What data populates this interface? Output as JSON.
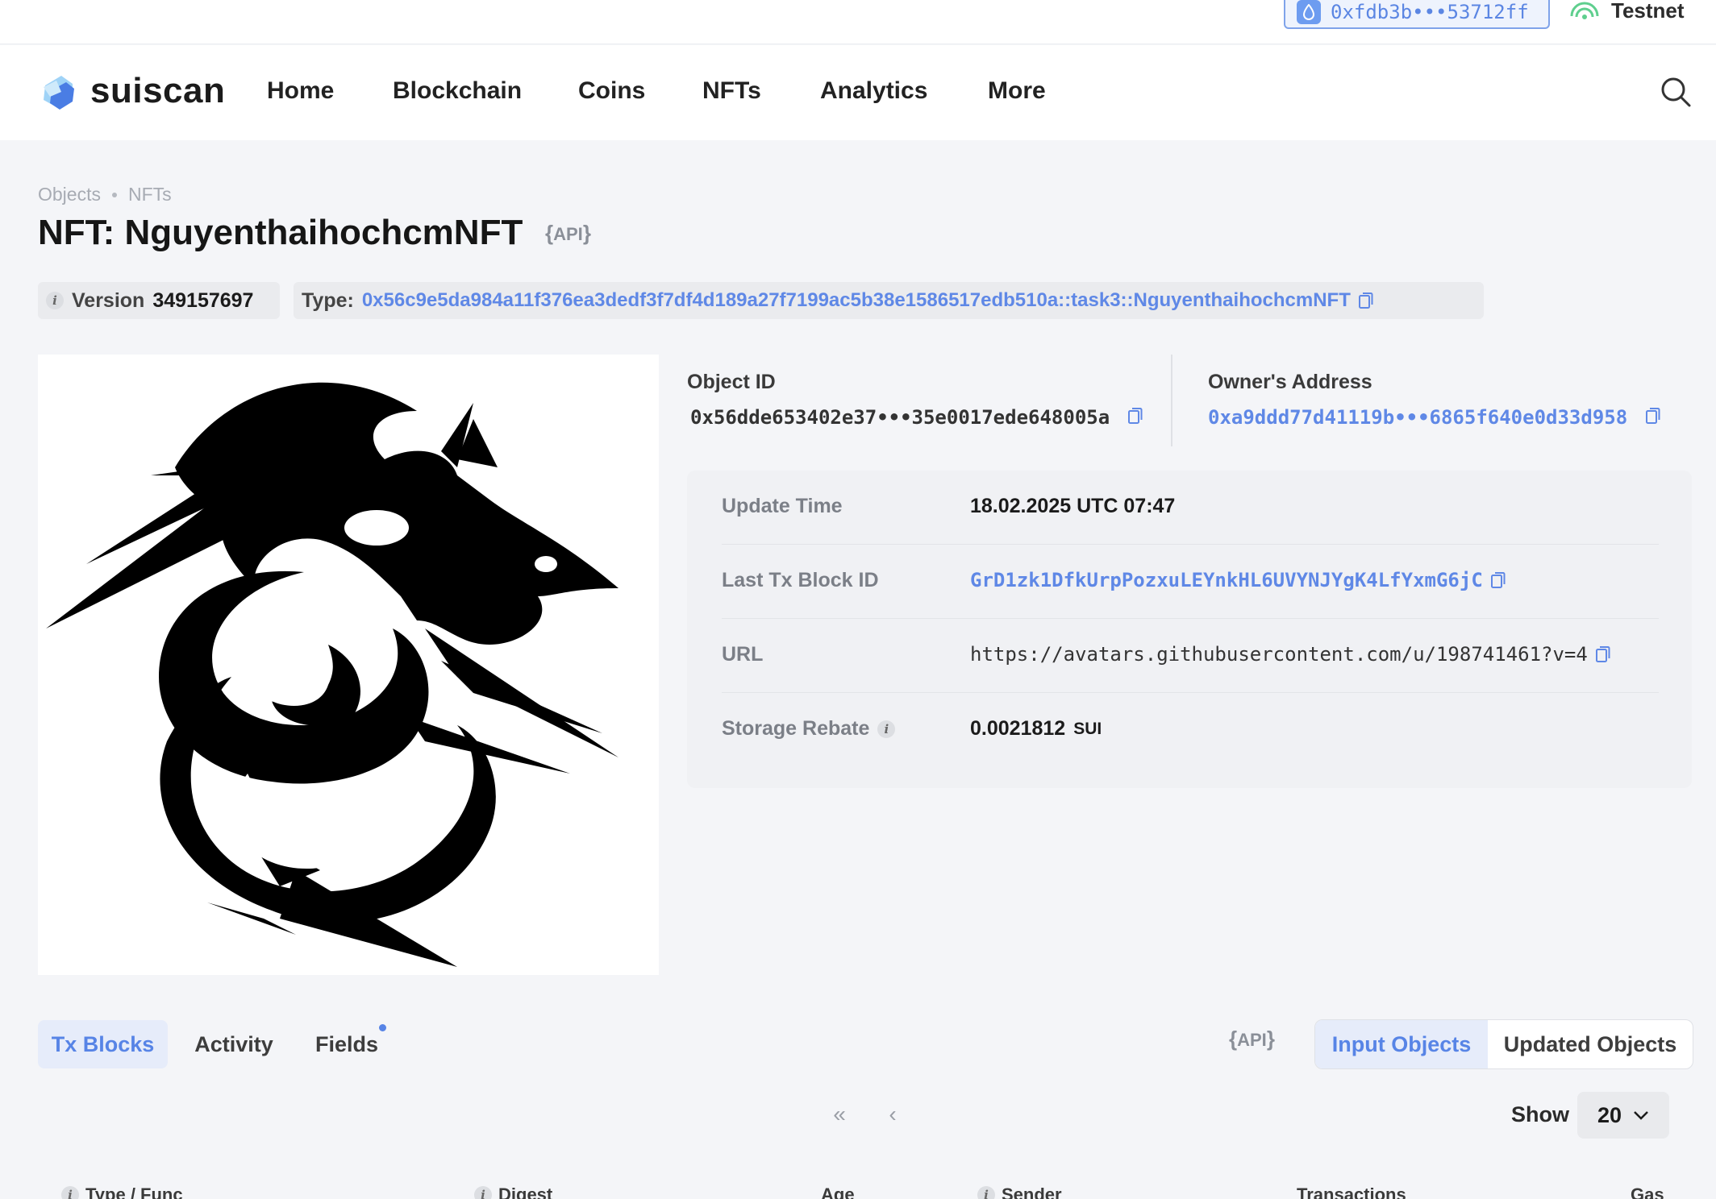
{
  "topbar": {
    "wallet_address": "0xfdb3b•••53712ff",
    "network": "Testnet"
  },
  "nav": {
    "logo": "suiscan",
    "items": [
      "Home",
      "Blockchain",
      "Coins",
      "NFTs",
      "Analytics",
      "More"
    ]
  },
  "breadcrumb": [
    "Objects",
    "NFTs"
  ],
  "page": {
    "title": "NFT: NguyenthaihochcmNFT",
    "api_label": "API",
    "version_label": "Version",
    "version_value": "349157697",
    "type_label": "Type:",
    "type_value": "0x56c9e5da984a11f376ea3dedf3f7df4d189a27f7199ac5b38e1586517edb510a::task3::NguyenthaihochcmNFT"
  },
  "ids": {
    "object_id_label": "Object ID",
    "object_id_value": "0x56dde653402e37•••35e0017ede648005a",
    "owner_label": "Owner's Address",
    "owner_value": "0xa9ddd77d41119b•••6865f640e0d33d958"
  },
  "details": {
    "update_time_label": "Update Time",
    "update_time_value": "18.02.2025 UTC 07:47",
    "last_tx_label": "Last Tx Block ID",
    "last_tx_value": "GrD1zk1DfkUrpPozxuLEYnkHL6UVYNJYgK4LfYxmG6jC",
    "url_label": "URL",
    "url_value": "https://avatars.githubusercontent.com/u/198741461?v=4",
    "storage_label": "Storage Rebate",
    "storage_value": "0.0021812",
    "storage_unit": "SUI"
  },
  "tabs": {
    "items": [
      "Tx Blocks",
      "Activity",
      "Fields"
    ],
    "api_label": "API",
    "toggle": [
      "Input Objects",
      "Updated Objects"
    ]
  },
  "pager": {
    "first": "«",
    "prev": "‹",
    "show_label": "Show",
    "show_value": "20"
  },
  "table": {
    "headers": [
      "Type / Func",
      "Digest",
      "Age",
      "Sender",
      "Transactions",
      "Gas"
    ]
  },
  "colors": {
    "accent": "#5784e6",
    "background": "#f4f5f8"
  }
}
